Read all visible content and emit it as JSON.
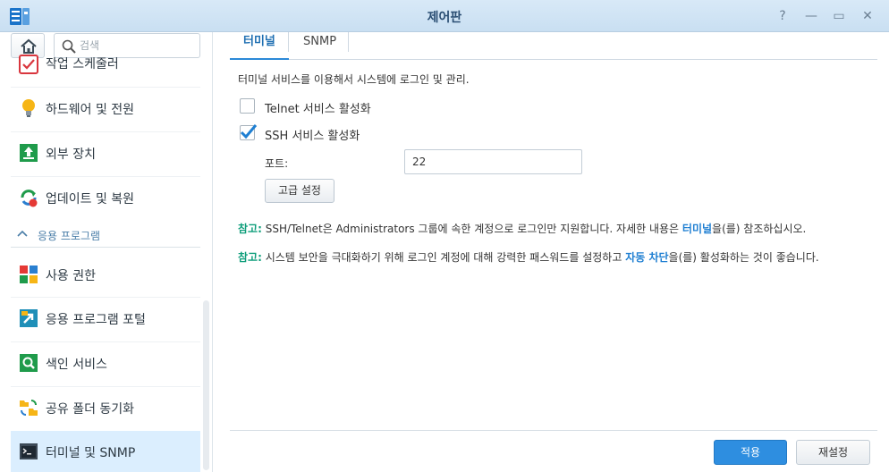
{
  "window": {
    "title": "제어판",
    "controls": {
      "help": "?",
      "minimize": "—",
      "maximize": "▭",
      "close": "✕"
    }
  },
  "sidebar": {
    "search_placeholder": "검색",
    "items_top": [
      {
        "label": "작업 스케줄러",
        "icon": "task-scheduler-icon"
      },
      {
        "label": "하드웨어 및 전원",
        "icon": "lightbulb-icon"
      },
      {
        "label": "외부 장치",
        "icon": "external-device-icon"
      },
      {
        "label": "업데이트 및 복원",
        "icon": "update-restore-icon"
      }
    ],
    "section_label": "응용 프로그램",
    "items_apps": [
      {
        "label": "사용 권한",
        "icon": "privileges-icon"
      },
      {
        "label": "응용 프로그램 포털",
        "icon": "app-portal-icon"
      },
      {
        "label": "색인 서비스",
        "icon": "indexing-service-icon"
      },
      {
        "label": "공유 폴더 동기화",
        "icon": "shared-folder-sync-icon"
      },
      {
        "label": "터미널 및 SNMP",
        "icon": "terminal-icon",
        "active": true
      }
    ]
  },
  "tabs": [
    {
      "label": "터미널",
      "active": true
    },
    {
      "label": "SNMP",
      "active": false
    }
  ],
  "content": {
    "description": "터미널 서비스를 이용해서 시스템에 로그인 및 관리.",
    "telnet_label": "Telnet 서비스 활성화",
    "telnet_checked": false,
    "ssh_label": "SSH 서비스 활성화",
    "ssh_checked": true,
    "port_label": "포트:",
    "port_value": "22",
    "advanced_button": "고급 설정",
    "note1": {
      "tag": "참고:",
      "text_before": " SSH/Telnet은 Administrators 그룹에 속한 계정으로 로그인만 지원합니다. 자세한 내용은 ",
      "link": "터미널",
      "text_after": "을(를) 참조하십시오."
    },
    "note2": {
      "tag": "참고:",
      "text_before": " 시스템 보안을 극대화하기 위해 로그인 계정에 대해 강력한 패스워드를 설정하고 ",
      "link": "자동 차단",
      "text_after": "을(를) 활성화하는 것이 좋습니다."
    }
  },
  "footer": {
    "apply": "적용",
    "reset": "재설정"
  },
  "colors": {
    "accent": "#2e8ee0",
    "note_tag": "#0f9e7b",
    "link": "#1f7fd2",
    "active_item_bg": "#dbeefe"
  }
}
